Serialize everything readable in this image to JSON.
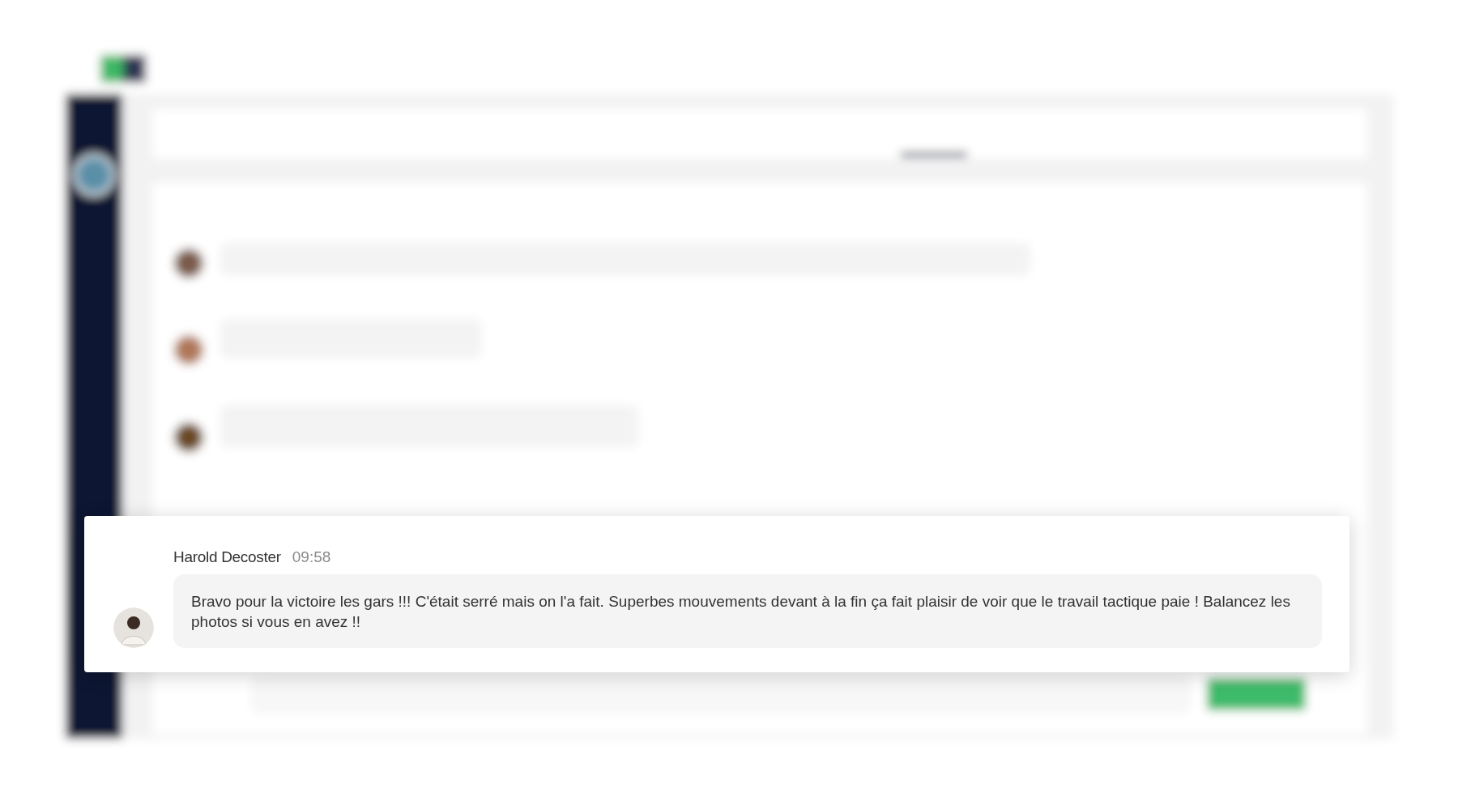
{
  "message": {
    "author": "Harold Decoster",
    "time": "09:58",
    "text": "Bravo pour la victoire les gars !!! C'était serré mais on l'a fait. Superbes mouvements devant à la fin ça fait plaisir de voir que le travail tactique paie ! Balancez les photos si vous en avez !!"
  }
}
